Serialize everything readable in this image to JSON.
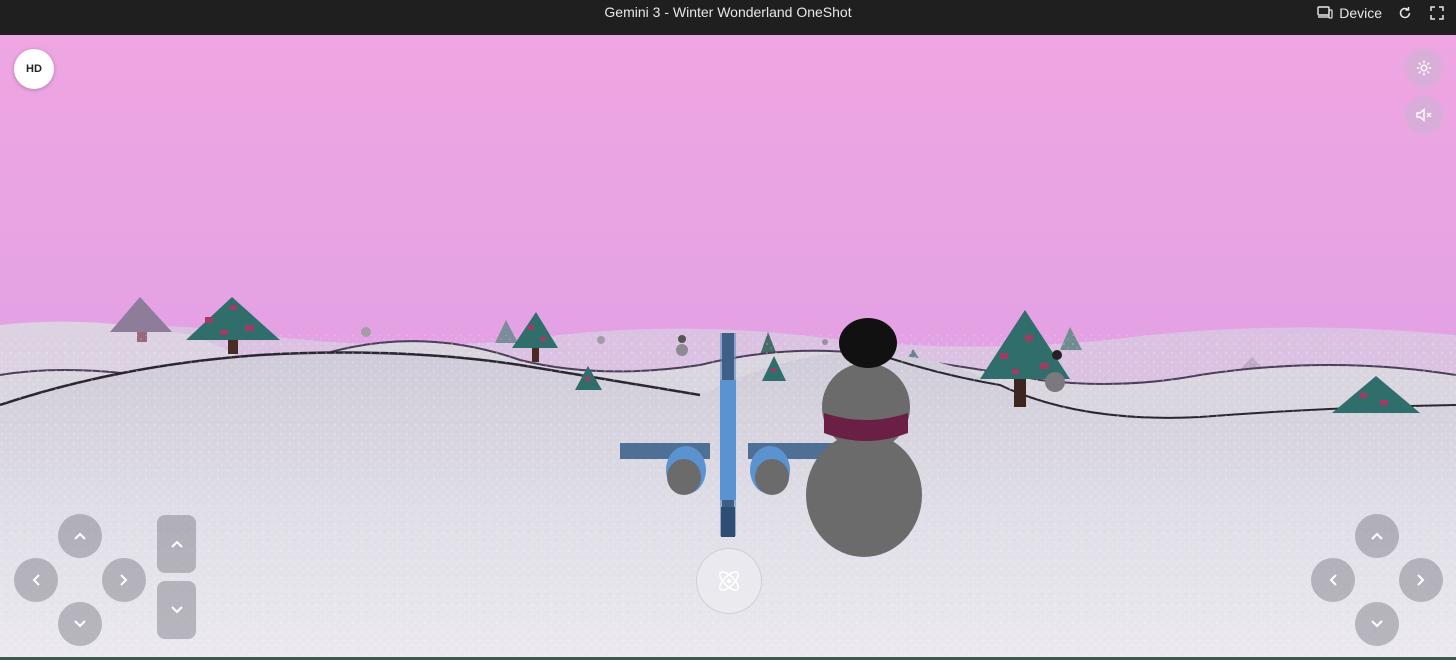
{
  "window": {
    "title": "Gemini 3 - Winter Wonderland OneShot",
    "device_label": "Device",
    "icons": [
      "device-icon",
      "refresh-icon",
      "fullscreen-icon"
    ]
  },
  "game": {
    "quality_button_label": "HD",
    "top_right_controls": [
      "settings-icon",
      "mute-icon"
    ],
    "left_dpad": [
      "up",
      "left",
      "right",
      "down"
    ],
    "altitude_controls": [
      "up",
      "down"
    ],
    "center_action": "atom-icon",
    "right_dpad": [
      "up",
      "left",
      "right",
      "down"
    ]
  },
  "colors": {
    "sky_top": "#efa6e2",
    "sky_bottom": "#d79ee6",
    "snow": "#e2e1ea",
    "tree": "#2f6e6a",
    "tree_accent": "#a23a63",
    "snowman": "#6b6b6b",
    "hat": "#111111",
    "scarf": "#6a1f45",
    "aircraft": "#4f85c2"
  }
}
